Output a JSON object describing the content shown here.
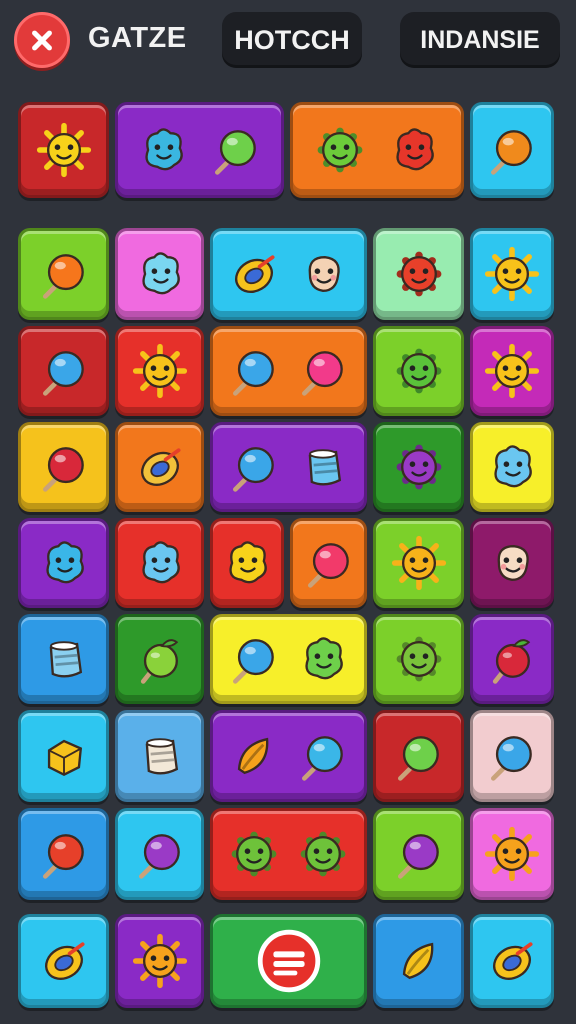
{
  "header": {
    "close_icon": "close-x-icon",
    "title": "GATZE",
    "tab_left": "HOTCCH",
    "tab_right": "INDANSIE"
  },
  "tile_colors": {
    "red": "#c8282a",
    "purple": "#8a2ac6",
    "orange": "#f2771c",
    "cyan": "#2ec6f0",
    "lime": "#7cd02a",
    "pink": "#f06ae0",
    "mint": "#98ecb0",
    "magenta": "#c42ab8",
    "yellow": "#f5c21c",
    "darkgreen": "#2e9a2a",
    "brightyellow": "#f7ef2a",
    "maroon": "#8e1a6a",
    "blue": "#2e9ae6",
    "skyblue": "#5ab0ea",
    "lightpink": "#f2cccf",
    "green": "#2fb04a",
    "red2": "#e6302a"
  },
  "board": {
    "tiles": [
      {
        "row": 0,
        "cols": [
          0,
          1
        ],
        "color": "red",
        "icons": [
          {
            "shape": "sun",
            "color": "#f7d21a"
          }
        ]
      },
      {
        "row": 0,
        "cols": [
          1,
          3
        ],
        "color": "purple",
        "icons": [
          {
            "shape": "blob",
            "color": "#3ab6e0"
          },
          {
            "shape": "lollipop",
            "color": "#6ed04a"
          }
        ]
      },
      {
        "row": 0,
        "cols": [
          3,
          5
        ],
        "color": "orange",
        "icons": [
          {
            "shape": "virus",
            "color": "#6ccb3a"
          },
          {
            "shape": "blob",
            "color": "#e6362a"
          }
        ]
      },
      {
        "row": 0,
        "cols": [
          5,
          6
        ],
        "color": "cyan",
        "icons": [
          {
            "shape": "lollipop",
            "color": "#f08a1c"
          }
        ]
      },
      {
        "row": 1,
        "cols": [
          0,
          1
        ],
        "color": "lime",
        "icons": [
          {
            "shape": "lollipop",
            "color": "#f6761c"
          }
        ]
      },
      {
        "row": 1,
        "cols": [
          1,
          2
        ],
        "color": "pink",
        "icons": [
          {
            "shape": "blob",
            "color": "#7ad6f0"
          }
        ]
      },
      {
        "row": 1,
        "cols": [
          2,
          4
        ],
        "color": "cyan",
        "icons": [
          {
            "shape": "ring",
            "color": "#f6c21c"
          },
          {
            "shape": "face",
            "color": "#f4d2b4"
          }
        ]
      },
      {
        "row": 1,
        "cols": [
          4,
          5
        ],
        "color": "mint",
        "icons": [
          {
            "shape": "virus",
            "color": "#e8402a"
          }
        ]
      },
      {
        "row": 1,
        "cols": [
          5,
          6
        ],
        "color": "cyan",
        "icons": [
          {
            "shape": "sun",
            "color": "#f7c21a"
          }
        ]
      },
      {
        "row": 2,
        "cols": [
          0,
          1
        ],
        "color": "red",
        "icons": [
          {
            "shape": "lollipop",
            "color": "#3aa6e8"
          }
        ]
      },
      {
        "row": 2,
        "cols": [
          1,
          2
        ],
        "color": "red2",
        "icons": [
          {
            "shape": "sun",
            "color": "#f7c21a"
          }
        ]
      },
      {
        "row": 2,
        "cols": [
          2,
          4
        ],
        "color": "orange",
        "icons": [
          {
            "shape": "lollipop",
            "color": "#3aa6e8"
          },
          {
            "shape": "lollipop",
            "color": "#f23a8a"
          }
        ]
      },
      {
        "row": 2,
        "cols": [
          4,
          5
        ],
        "color": "lime",
        "icons": [
          {
            "shape": "virus",
            "color": "#5ac23a"
          }
        ]
      },
      {
        "row": 2,
        "cols": [
          5,
          6
        ],
        "color": "magenta",
        "icons": [
          {
            "shape": "sun",
            "color": "#f7c21a"
          }
        ]
      },
      {
        "row": 3,
        "cols": [
          0,
          1
        ],
        "color": "yellow",
        "icons": [
          {
            "shape": "lollipop",
            "color": "#d8283a"
          }
        ]
      },
      {
        "row": 3,
        "cols": [
          1,
          2
        ],
        "color": "orange",
        "icons": [
          {
            "shape": "ring",
            "color": "#f2c23a"
          }
        ]
      },
      {
        "row": 3,
        "cols": [
          2,
          4
        ],
        "color": "purple",
        "icons": [
          {
            "shape": "lollipop",
            "color": "#3aa6e8"
          },
          {
            "shape": "cup",
            "color": "#6ac6f0"
          }
        ]
      },
      {
        "row": 3,
        "cols": [
          4,
          5
        ],
        "color": "darkgreen",
        "icons": [
          {
            "shape": "virus",
            "color": "#9a3ac6"
          }
        ]
      },
      {
        "row": 3,
        "cols": [
          5,
          6
        ],
        "color": "brightyellow",
        "icons": [
          {
            "shape": "blob",
            "color": "#6ac6f0"
          }
        ]
      },
      {
        "row": 4,
        "cols": [
          0,
          1
        ],
        "color": "purple",
        "icons": [
          {
            "shape": "blob",
            "color": "#3ab6e8"
          }
        ]
      },
      {
        "row": 4,
        "cols": [
          1,
          2
        ],
        "color": "red2",
        "icons": [
          {
            "shape": "blob",
            "color": "#6ac6f0"
          }
        ]
      },
      {
        "row": 4,
        "cols": [
          2,
          3
        ],
        "color": "red2",
        "icons": [
          {
            "shape": "blob",
            "color": "#f7d21a"
          }
        ]
      },
      {
        "row": 4,
        "cols": [
          3,
          4
        ],
        "color": "orange",
        "icons": [
          {
            "shape": "lollipop",
            "color": "#f23a6a"
          }
        ]
      },
      {
        "row": 4,
        "cols": [
          4,
          5
        ],
        "color": "lime",
        "icons": [
          {
            "shape": "sun",
            "color": "#f7b21a"
          }
        ]
      },
      {
        "row": 4,
        "cols": [
          5,
          6
        ],
        "color": "maroon",
        "icons": [
          {
            "shape": "face",
            "color": "#f6dcc4"
          }
        ]
      },
      {
        "row": 5,
        "cols": [
          0,
          1
        ],
        "color": "blue",
        "icons": [
          {
            "shape": "cup",
            "color": "#8ad0f0"
          }
        ]
      },
      {
        "row": 5,
        "cols": [
          1,
          2
        ],
        "color": "darkgreen",
        "icons": [
          {
            "shape": "apple",
            "color": "#8ad23a"
          }
        ]
      },
      {
        "row": 5,
        "cols": [
          2,
          4
        ],
        "color": "brightyellow",
        "icons": [
          {
            "shape": "lollipop",
            "color": "#3aa6e8"
          },
          {
            "shape": "blob",
            "color": "#6ed04a"
          }
        ]
      },
      {
        "row": 5,
        "cols": [
          4,
          5
        ],
        "color": "lime",
        "icons": [
          {
            "shape": "virus",
            "color": "#7ac23a"
          }
        ]
      },
      {
        "row": 5,
        "cols": [
          5,
          6
        ],
        "color": "purple",
        "icons": [
          {
            "shape": "apple",
            "color": "#d8283a"
          }
        ]
      },
      {
        "row": 6,
        "cols": [
          0,
          1
        ],
        "color": "cyan",
        "icons": [
          {
            "shape": "box",
            "color": "#f6c21c"
          }
        ]
      },
      {
        "row": 6,
        "cols": [
          1,
          2
        ],
        "color": "skyblue",
        "icons": [
          {
            "shape": "cup",
            "color": "#f2e8d8"
          }
        ]
      },
      {
        "row": 6,
        "cols": [
          2,
          4
        ],
        "color": "purple",
        "icons": [
          {
            "shape": "leaf",
            "color": "#f6a21c"
          },
          {
            "shape": "lollipop",
            "color": "#3ab6e8"
          }
        ]
      },
      {
        "row": 6,
        "cols": [
          4,
          5
        ],
        "color": "red",
        "icons": [
          {
            "shape": "lollipop",
            "color": "#6ed04a"
          }
        ]
      },
      {
        "row": 6,
        "cols": [
          5,
          6
        ],
        "color": "lightpink",
        "icons": [
          {
            "shape": "lollipop",
            "color": "#3aa6e8"
          }
        ]
      },
      {
        "row": 7,
        "cols": [
          0,
          1
        ],
        "color": "blue",
        "icons": [
          {
            "shape": "lollipop",
            "color": "#e6402a"
          }
        ]
      },
      {
        "row": 7,
        "cols": [
          1,
          2
        ],
        "color": "cyan",
        "icons": [
          {
            "shape": "lollipop",
            "color": "#9a3ac6"
          }
        ]
      },
      {
        "row": 7,
        "cols": [
          2,
          4
        ],
        "color": "red2",
        "icons": [
          {
            "shape": "virus",
            "color": "#6ec23a"
          },
          {
            "shape": "virus",
            "color": "#6ec23a"
          }
        ]
      },
      {
        "row": 7,
        "cols": [
          4,
          5
        ],
        "color": "lime",
        "icons": [
          {
            "shape": "lollipop",
            "color": "#9a3ac6"
          }
        ]
      },
      {
        "row": 7,
        "cols": [
          5,
          6
        ],
        "color": "pink",
        "icons": [
          {
            "shape": "sun",
            "color": "#f6a21c"
          }
        ]
      },
      {
        "row": 8,
        "cols": [
          0,
          1
        ],
        "color": "cyan",
        "icons": [
          {
            "shape": "ring",
            "color": "#f6c21c"
          }
        ]
      },
      {
        "row": 8,
        "cols": [
          1,
          2
        ],
        "color": "purple",
        "icons": [
          {
            "shape": "sun",
            "color": "#f6a21c"
          }
        ]
      },
      {
        "row": 8,
        "cols": [
          2,
          4
        ],
        "color": "green",
        "icons": [
          {
            "shape": "badge",
            "color": "#e6302a"
          }
        ]
      },
      {
        "row": 8,
        "cols": [
          4,
          5
        ],
        "color": "blue",
        "icons": [
          {
            "shape": "leaf",
            "color": "#f6c21c"
          }
        ]
      },
      {
        "row": 8,
        "cols": [
          5,
          6
        ],
        "color": "cyan",
        "icons": [
          {
            "shape": "ring",
            "color": "#f6c21c"
          }
        ]
      }
    ]
  }
}
